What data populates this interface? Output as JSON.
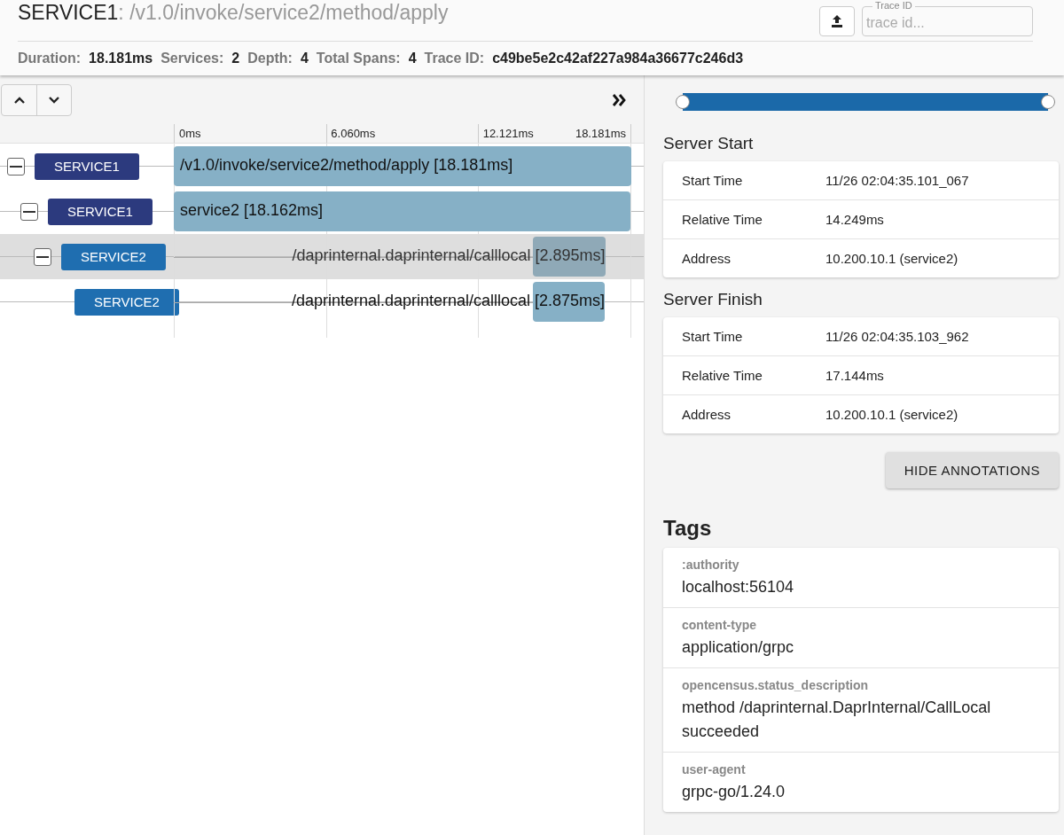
{
  "header": {
    "service": "SERVICE1",
    "operation": ": /v1.0/invoke/service2/method/apply",
    "trace_field": {
      "label": "Trace ID",
      "placeholder": "trace id..."
    },
    "stats": [
      {
        "label": "Duration:",
        "value": "18.181ms"
      },
      {
        "label": "Services:",
        "value": "2"
      },
      {
        "label": "Depth:",
        "value": "4"
      },
      {
        "label": "Total Spans:",
        "value": "4"
      },
      {
        "label": "Trace ID:",
        "value": "c49be5e2c42af227a984a36677c246d3"
      }
    ]
  },
  "timeline": {
    "ticks": [
      "0ms",
      "6.060ms",
      "12.121ms",
      "18.181ms"
    ],
    "spans": [
      {
        "service": "SERVICE1",
        "color": "#2c3a7e",
        "label": "/v1.0/invoke/service2/method/apply [18.181ms]",
        "selected": false,
        "expanded": true,
        "start": {
          "level": 0
        },
        "end": {
          "level": 1
        },
        "children": [
          {
            "service": "SERVICE1",
            "color": "#2c3a7e",
            "label": "service2 [18.162ms]",
            "selected": false,
            "expanded": true,
            "start": {
              "level": 0
            },
            "end": {
              "level": 0.999
            },
            "children": [
              {
                "service": "SERVICE2",
                "color": "#1f6eb0",
                "label": "/daprinternal.daprinternal/calllocal [2.895ms]",
                "selected": true,
                "expanded": true,
                "start": {
                  "level": 0.784
                },
                "end": {
                  "level": 0.943
                },
                "children": [
                  {
                    "service": "SERVICE2",
                    "color": "#1f6eb0",
                    "label": "/daprinternal.daprinternal/calllocal [2.875ms]",
                    "selected": false,
                    "start": {
                      "level": 0.784
                    },
                    "end": {
                      "level": 0.942
                    }
                  }
                ]
              }
            ]
          }
        ]
      }
    ]
  },
  "detail": {
    "range": {
      "start": {
        "level": 0
      },
      "end": {
        "level": 1
      }
    },
    "annotations": [
      {
        "title": "Server Start",
        "rows": [
          {
            "label": "Start Time",
            "value": "11/26 02:04:35.101_067"
          },
          {
            "label": "Relative Time",
            "value": "14.249ms"
          },
          {
            "label": "Address",
            "value": "10.200.10.1 (service2)"
          }
        ]
      },
      {
        "title": "Server Finish",
        "rows": [
          {
            "label": "Start Time",
            "value": "11/26 02:04:35.103_962"
          },
          {
            "label": "Relative Time",
            "value": "17.144ms"
          },
          {
            "label": "Address",
            "value": "10.200.10.1 (service2)"
          }
        ]
      }
    ],
    "hide_button": "HIDE ANNOTATIONS",
    "tags_title": "Tags",
    "tags": [
      {
        "key": ":authority",
        "value": "localhost:56104"
      },
      {
        "key": "content-type",
        "value": "application/grpc"
      },
      {
        "key": "opencensus.status_description",
        "value": "method /daprinternal.DaprInternal/CallLocal succeeded"
      },
      {
        "key": "user-agent",
        "value": "grpc-go/1.24.0"
      }
    ]
  }
}
